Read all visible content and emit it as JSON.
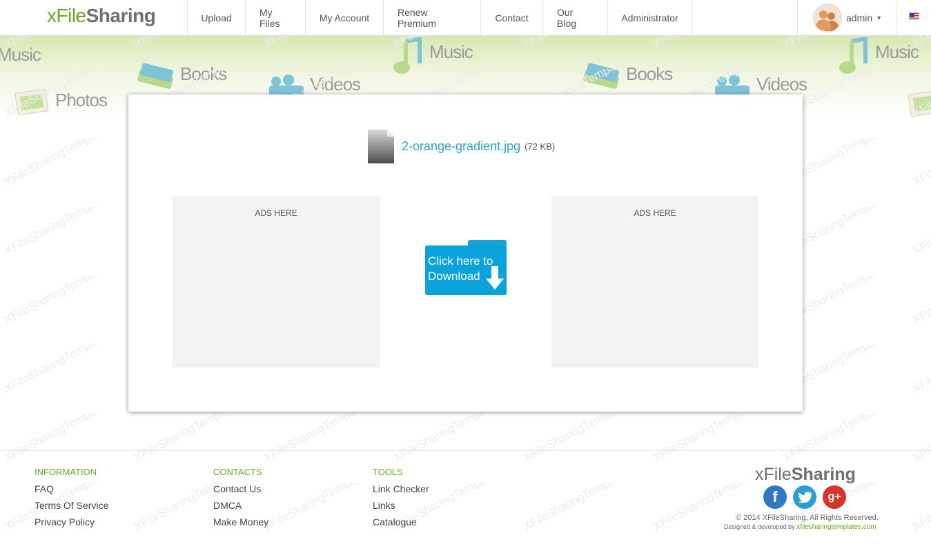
{
  "header": {
    "logo": {
      "x": "x",
      "file": "File",
      "sharing": "Sharing"
    },
    "nav": [
      "Upload",
      "My Files",
      "My Account",
      "Renew Premium",
      "Contact",
      "Our Blog",
      "Administrator"
    ],
    "user": {
      "name": "admin"
    }
  },
  "banner": {
    "labels": [
      "Music",
      "Books",
      "Photos",
      "Videos",
      "Music",
      "Books",
      "Videos",
      "Music"
    ]
  },
  "watermark": {
    "text": "XFileSharingTemplates"
  },
  "file": {
    "name": "2-orange-gradient.jpg",
    "size": "(72 KB)"
  },
  "ads": {
    "left": "ADS HERE",
    "right": "ADS HERE"
  },
  "download": {
    "line1": "Click here to",
    "line2": "Download"
  },
  "footer": {
    "columns": [
      {
        "title": "INFORMATION",
        "links": [
          "FAQ",
          "Terms Of Service",
          "Privacy Policy"
        ]
      },
      {
        "title": "CONTACTS",
        "links": [
          "Contact Us",
          "DMCA",
          "Make Money"
        ]
      },
      {
        "title": "TOOLS",
        "links": [
          "Link Checker",
          "Links",
          "Catalogue"
        ]
      }
    ],
    "logo": {
      "x": "xFile",
      "sharing": "Sharing"
    },
    "social": {
      "facebook": "f",
      "twitter": "t",
      "googleplus": "g+"
    },
    "copyright": "© 2014 XFileSharing, All Rights Reserved.",
    "designed_prefix": "Designed & developed by",
    "designed_link": "xfilesharingtemplates.com"
  },
  "colors": {
    "brand_green": "#6aa81e",
    "link_blue": "#2aa5d8",
    "download_blue": "#0aa3dc"
  }
}
